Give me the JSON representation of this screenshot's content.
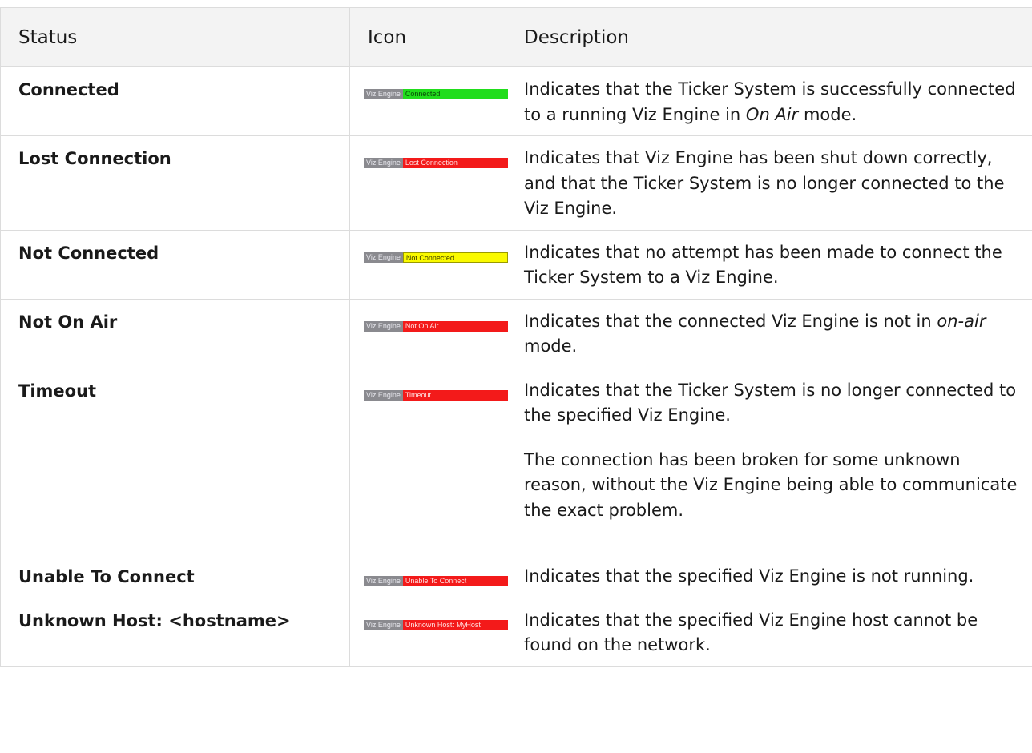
{
  "table": {
    "headers": {
      "status": "Status",
      "icon": "Icon",
      "description": "Description"
    },
    "rows": [
      {
        "status": "Connected",
        "badge_name": "Viz Engine",
        "badge_state": "Connected",
        "badge_color": "#21dd1c",
        "desc1": "Indicates that the Ticker System is successfully connected to a running Viz Engine in ",
        "desc1_em": "On Air",
        "desc1_tail": " mode."
      },
      {
        "status": "Lost Connection",
        "badge_name": "Viz Engine",
        "badge_state": "Lost Connection",
        "badge_color": "#f31a1a",
        "desc1": "Indicates that Viz Engine has been shut down correctly, and that the Ticker System is no longer connected to the Viz Engine."
      },
      {
        "status": "Not Connected",
        "badge_name": "Viz Engine",
        "badge_state": "Not Connected",
        "badge_color": "#fafa00",
        "desc1": "Indicates that no attempt has been made to connect the Ticker System to a Viz Engine."
      },
      {
        "status": "Not On Air",
        "badge_name": "Viz Engine",
        "badge_state": "Not On Air",
        "badge_color": "#f31a1a",
        "desc1": "Indicates that the connected Viz Engine is not in ",
        "desc1_em": "on-air",
        "desc1_tail": " mode."
      },
      {
        "status": "Timeout",
        "badge_name": "Viz Engine",
        "badge_state": "Timeout",
        "badge_color": "#f31a1a",
        "desc1": "Indicates that the Ticker System is no longer connected to the specified Viz Engine.",
        "desc2": "The connection has been broken for some unknown reason, without the Viz Engine being able to communicate the exact problem."
      },
      {
        "status": "Unable To Connect",
        "badge_name": "Viz Engine",
        "badge_state": "Unable To Connect",
        "badge_color": "#f31a1a",
        "desc1": "Indicates that the specified Viz Engine is not running."
      },
      {
        "status": "Unknown Host: <hostname>",
        "badge_name": "Viz Engine",
        "badge_state": "Unknown Host: MyHost",
        "badge_color": "#f31a1a",
        "desc1": "Indicates that the specified Viz Engine host cannot be found on the network."
      }
    ]
  }
}
